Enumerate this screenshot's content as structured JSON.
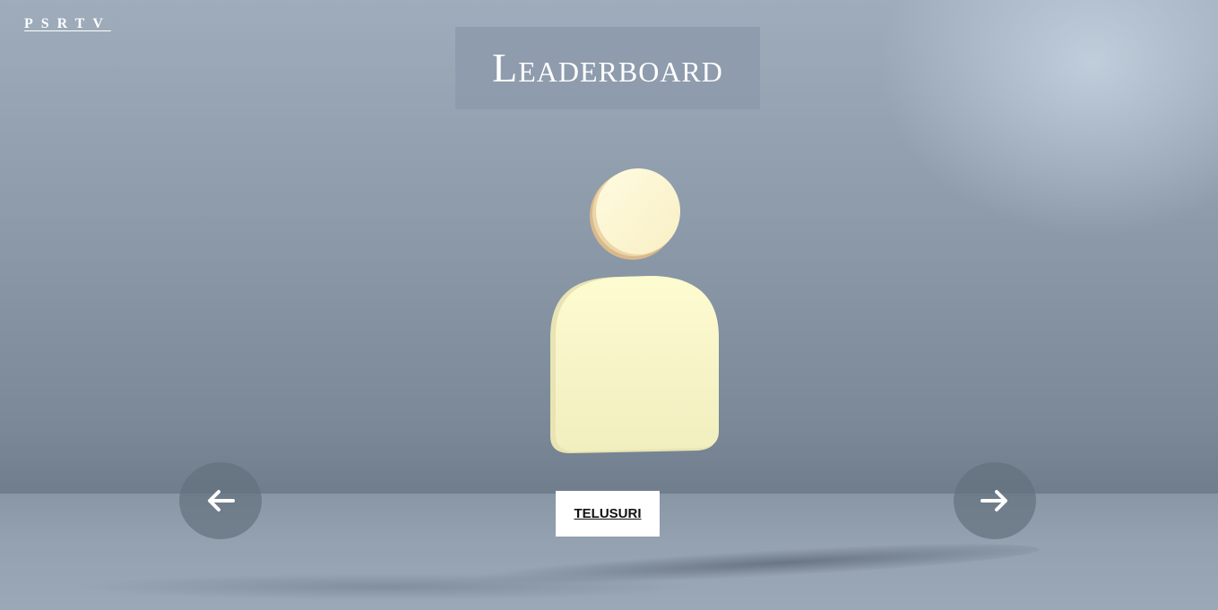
{
  "brand": {
    "label": "PSRTV"
  },
  "header": {
    "title": "Leaderboard"
  },
  "hero": {
    "icon": "user-avatar-3d"
  },
  "navigation": {
    "prev_icon": "arrow-left-icon",
    "next_icon": "arrow-right-icon"
  },
  "action": {
    "explore_label": "TELUSURI"
  },
  "colors": {
    "background": "#8d9bab",
    "title_box": "#8c9aac",
    "avatar_fill": "#fbf7c6",
    "button_bg": "#ffffff",
    "nav_bg": "#64707e"
  }
}
